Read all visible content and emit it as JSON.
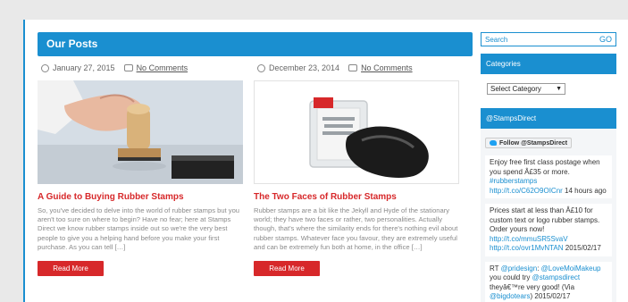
{
  "main": {
    "header": "Our Posts",
    "posts": [
      {
        "date": "January 27, 2015",
        "comments": "No Comments",
        "title": "A Guide to Buying Rubber Stamps",
        "excerpt": "So, you've decided to delve into the world of rubber stamps but you aren't too sure on where to begin? Have no fear; here at Stamps Direct we know rubber stamps inside out so we're the very best people to give you a helping hand before you make your first purchase. As you can tell […]",
        "read_more": "Read More"
      },
      {
        "date": "December 23, 2014",
        "comments": "No Comments",
        "title": "The Two Faces of Rubber Stamps",
        "excerpt": "Rubber stamps are a bit like the Jekyll and Hyde of the stationary world; they have two faces or rather, two personalities.  Actually though, that's where the similarity ends for there's nothing evil about rubber stamps. Whatever face you favour, they are extremely useful and can be extremely fun both at home, in the office […]",
        "read_more": "Read More"
      }
    ]
  },
  "sidebar": {
    "search_placeholder": "Search",
    "search_go": "GO",
    "categories_title": "Categories",
    "category_selected": "Select Category",
    "twitter_title": "@StampsDirect",
    "follow_label": "Follow @StampsDirect",
    "tweets": [
      {
        "text": "Enjoy free first class postage when you spend Â£35 or more.",
        "link": "#rubberstamps",
        "url": "http://t.co/C62O9OICnr",
        "time": "14 hours ago"
      },
      {
        "text": "Prices start at less than Â£10 for custom text or logo rubber stamps. Order yours now!",
        "url": "http://t.co/mmuSR5SvaV",
        "url2": "http://t.co/ovr1MvNTAN",
        "time": "2015/02/17"
      },
      {
        "prefix": "RT ",
        "handle1": "@pridesign",
        "sep": ": ",
        "handle2": "@LoveMoiMakeup",
        "text": " you could try ",
        "handle3": "@stampsdirect",
        "text2": " theyâ€™re very good! (Via ",
        "handle4": "@bigdotears",
        "text3": ")",
        "time": "2015/02/17"
      }
    ]
  },
  "colors": {
    "accent": "#1a8fd0",
    "button": "#d7282a",
    "title": "#d7282a"
  }
}
